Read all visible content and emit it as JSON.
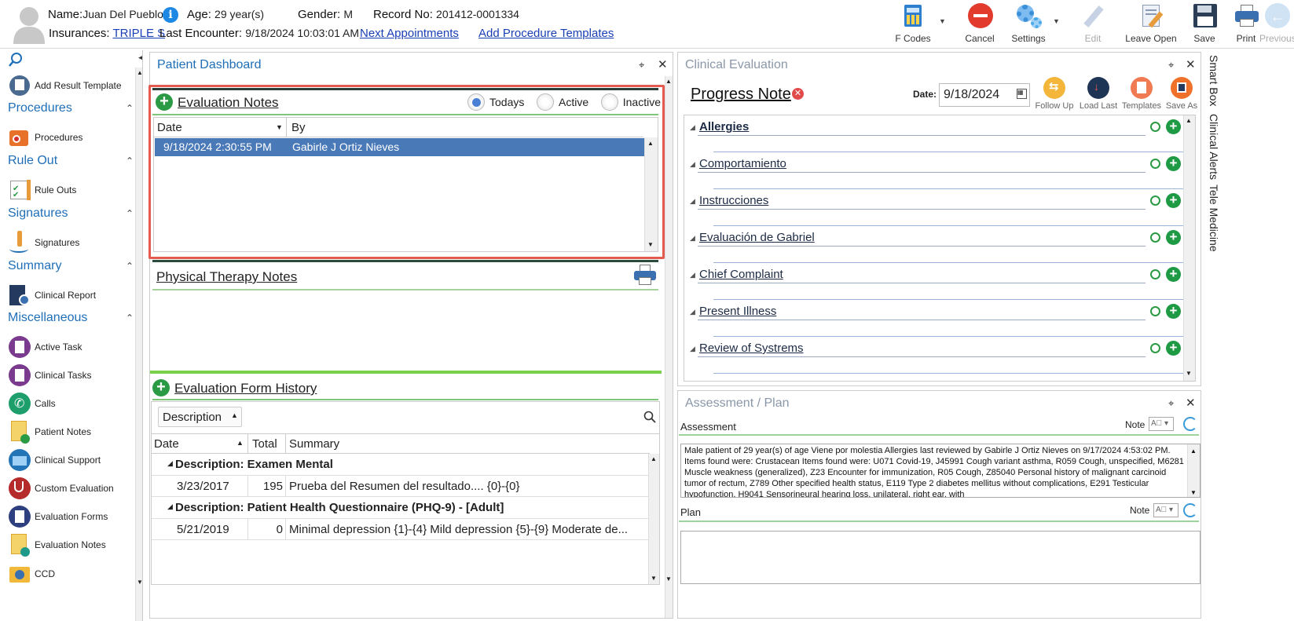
{
  "header": {
    "name_label": "Name:",
    "name_value": "Juan Del Pueblo",
    "age_label": "Age:",
    "age_value": "29 year(s)",
    "gender_label": "Gender:",
    "gender_value": "M",
    "record_label": "Record No:",
    "record_value": "201412-0001334",
    "insurances_label": "Insurances:",
    "insurances_value": "TRIPLE S",
    "last_encounter_label": "Last Encounter:",
    "last_encounter_value": "9/18/2024 10:03:01 AM",
    "next_appointments": "Next Appointments",
    "add_procedure_templates": "Add Procedure Templates"
  },
  "toolbar": {
    "fcodes": "F Codes",
    "cancel": "Cancel",
    "settings": "Settings",
    "edit": "Edit",
    "leave_open": "Leave Open",
    "save": "Save",
    "print": "Print",
    "previous": "Previous"
  },
  "leftnav": {
    "add_result_template": "Add Result Template",
    "sections": [
      {
        "title": "Procedures",
        "item": "Procedures"
      },
      {
        "title": "Rule Out",
        "item": "Rule Outs"
      },
      {
        "title": "Signatures",
        "item": "Signatures"
      },
      {
        "title": "Summary",
        "item": "Clinical Report"
      },
      {
        "title": "Miscellaneous",
        "item": "Active Task"
      }
    ],
    "misc_items": [
      "Clinical Tasks",
      "Calls",
      "Patient Notes",
      "Clinical Support",
      "Custom Evaluation",
      "Evaluation Forms",
      "Evaluation Notes",
      "CCD"
    ]
  },
  "dashboard": {
    "title": "Patient Dashboard",
    "pin": "⌖",
    "close": "✕",
    "eval_notes": {
      "title": "Evaluation Notes",
      "radio_todays": "Todays",
      "radio_active": "Active",
      "radio_inactive": "Inactive",
      "col_date": "Date",
      "col_by": "By",
      "rows": [
        {
          "date": "9/18/2024 2:30:55 PM",
          "by": "Gabirle J Ortiz Nieves"
        }
      ]
    },
    "pt_notes": {
      "title": "Physical Therapy Notes"
    },
    "form_history": {
      "title": "Evaluation Form History",
      "group_by": "Description",
      "col_date": "Date",
      "col_total": "Total",
      "col_summary": "Summary",
      "groups": [
        {
          "label": "Description: Examen Mental",
          "date": "3/23/2017",
          "total": "195",
          "summary": "Prueba del Resumen del resultado.... {0}-{0}"
        },
        {
          "label": "Description: Patient Health Questionnaire (PHQ-9) - [Adult]",
          "date": "5/21/2019",
          "total": "0",
          "summary": "Minimal depression {1}-{4}  Mild depression {5}-{9}  Moderate de..."
        }
      ]
    }
  },
  "clinical": {
    "title": "Clinical Evaluation",
    "note_title": "Progress Note",
    "date_label": "Date:",
    "date_value": "9/18/2024",
    "buttons": [
      "Follow Up",
      "Load Last",
      "Templates",
      "Save As"
    ],
    "sections": [
      "Allergies",
      "Comportamiento",
      "Instrucciones",
      "Evaluación de Gabriel",
      "Chief Complaint",
      "Present Illness",
      "Review of Systrems"
    ]
  },
  "assessment": {
    "title": "Assessment / Plan",
    "assessment_label": "Assessment",
    "note_label": "Note",
    "assessment_text": "Male patient of 29 year(s) of age Viene por molestia     Allergies last reviewed by Gabirle J Ortiz Nieves on 9/17/2024 4:53:02 PM.   Items found were:  Crustacean  Items found were:  U071 Covid-19, J45991 Cough variant asthma, R059 Cough, unspecified, M6281 Muscle weakness (generalized), Z23 Encounter for immunization, R05 Cough, Z85040 Personal history of malignant carcinoid tumor of rectum, Z789 Other specified health status, E119 Type 2 diabetes mellitus without complications, E291 Testicular hypofunction, H9041 Sensorineural hearing loss, unilateral, right ear, with",
    "plan_label": "Plan"
  },
  "sidetabs": [
    "Smart Box",
    "Clinical Alerts",
    "Tele Medicine"
  ],
  "colors": {
    "accent": "#1f6fb8",
    "selected_row": "#4a79b8",
    "green": "#2b9a44",
    "highlight_border": "#e35b4f"
  }
}
